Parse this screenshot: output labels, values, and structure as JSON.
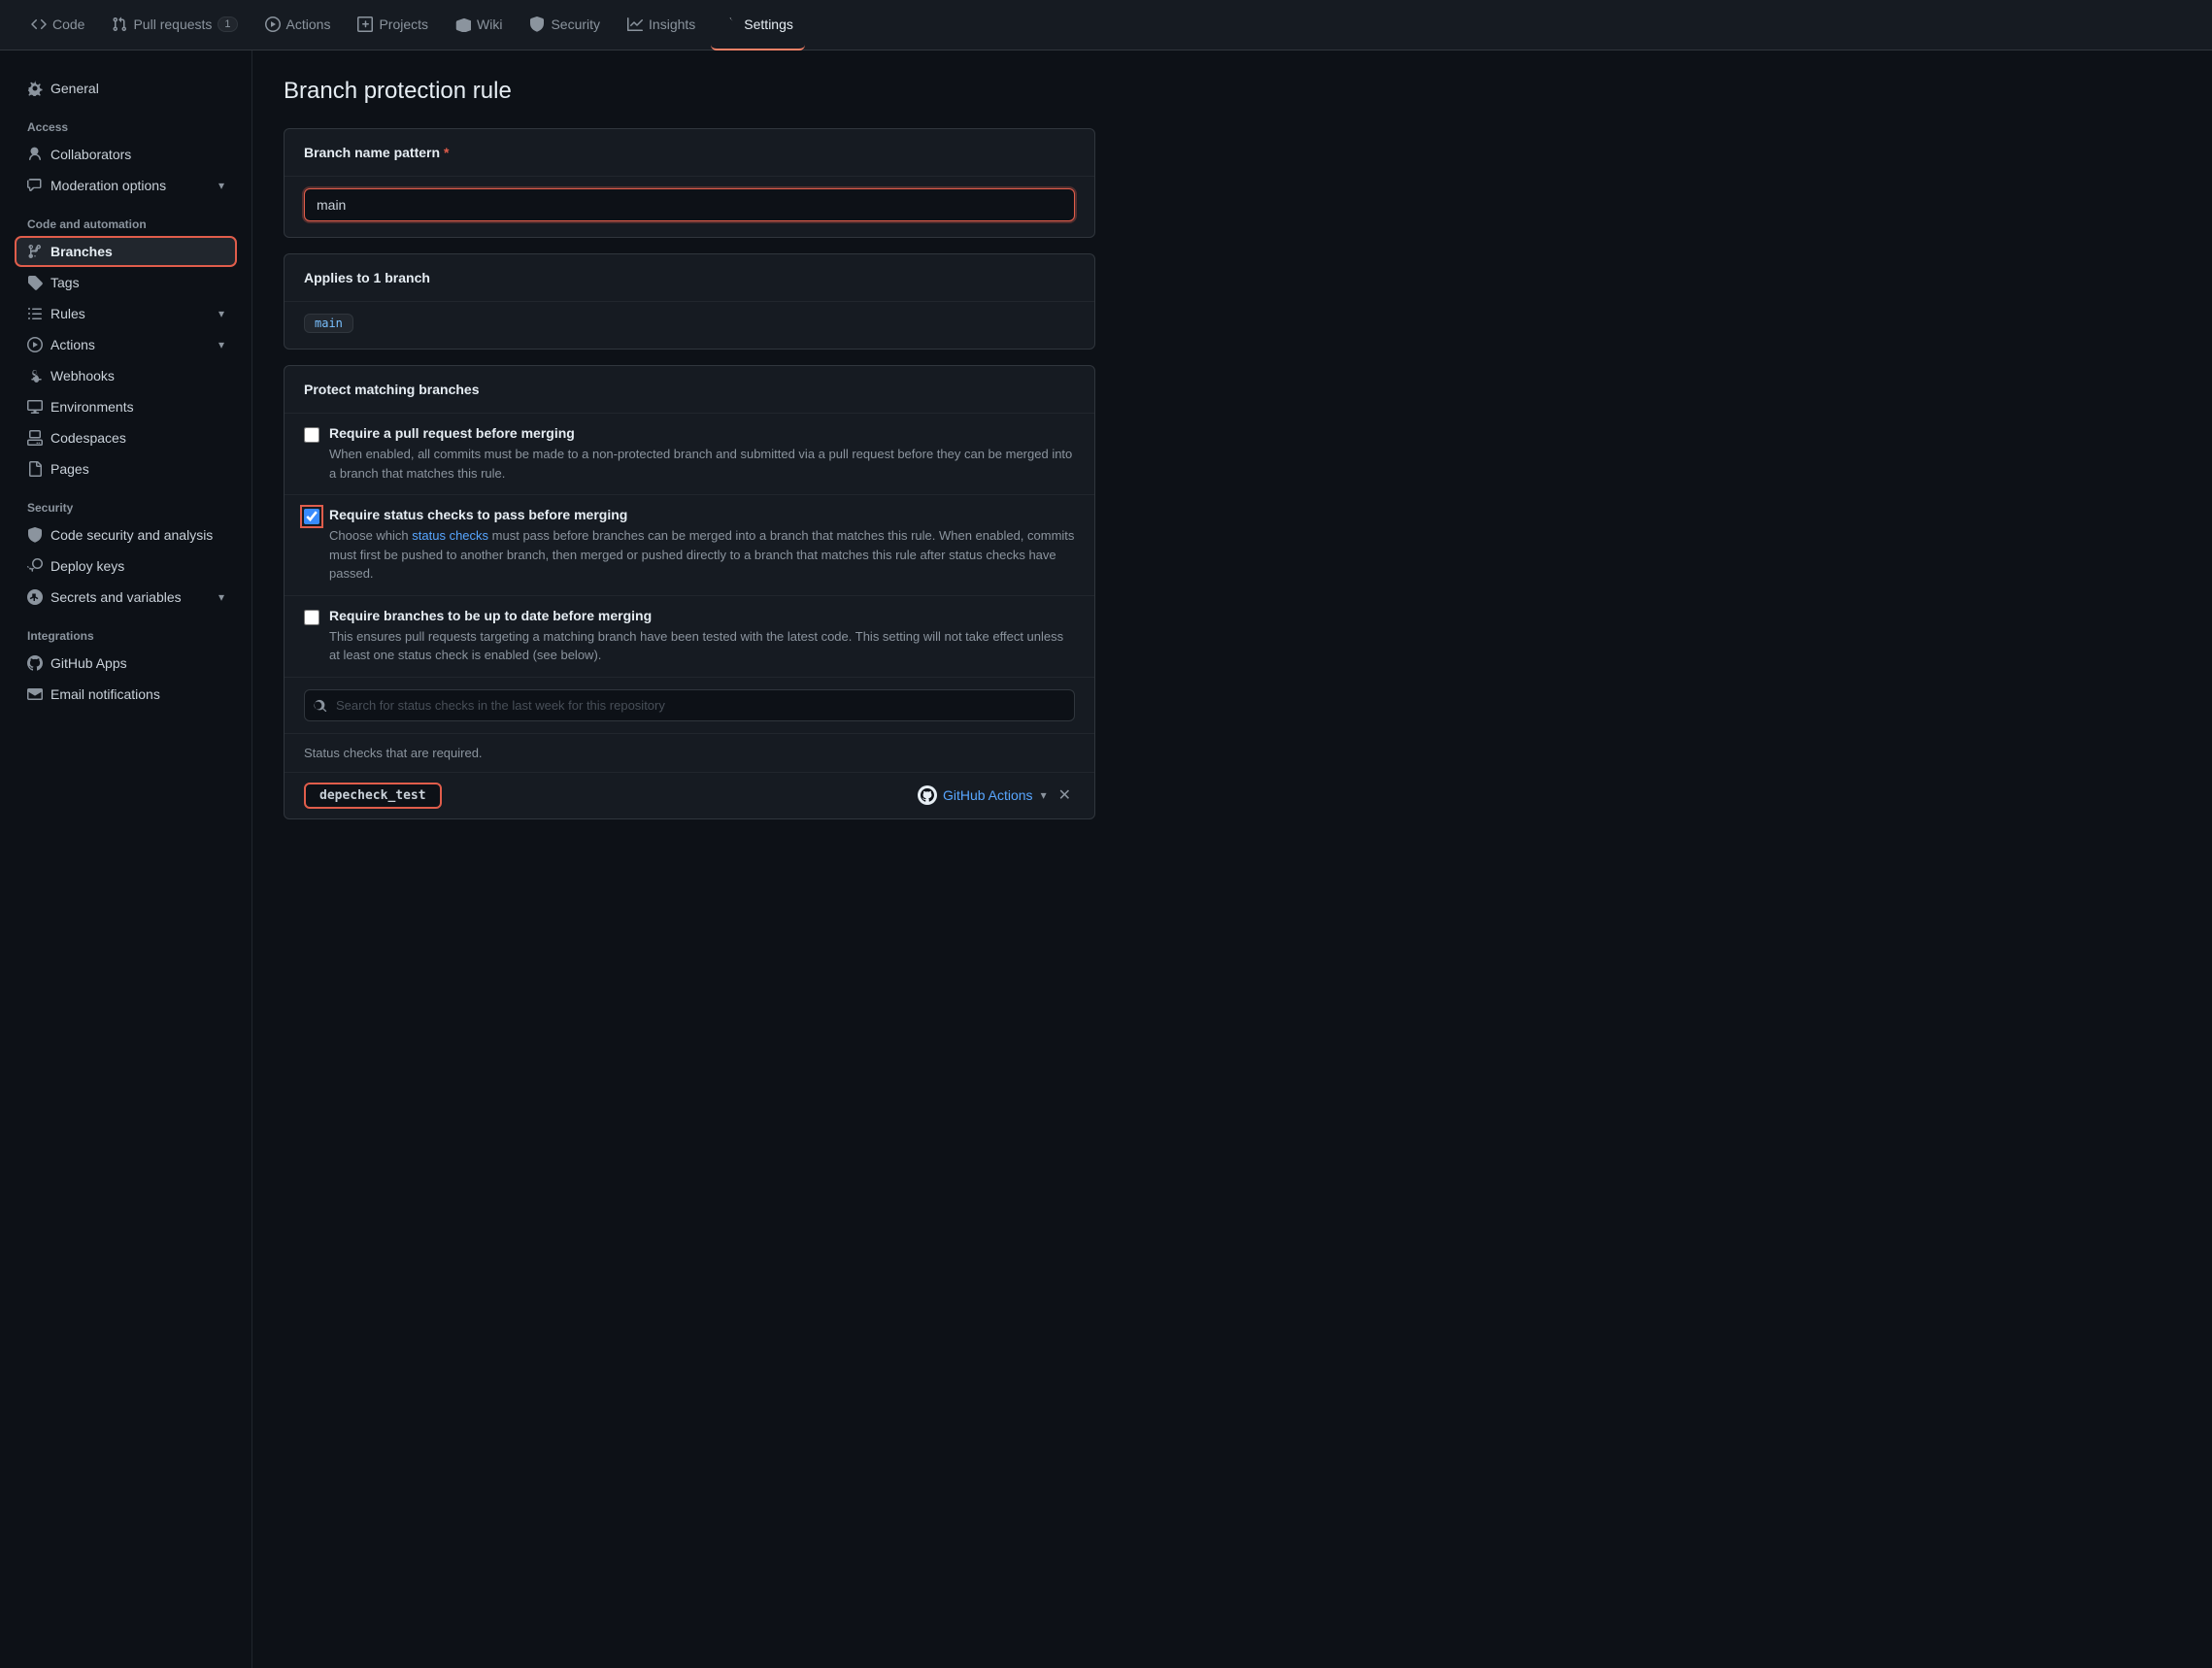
{
  "nav": {
    "items": [
      {
        "id": "code",
        "label": "Code",
        "icon": "code",
        "badge": null,
        "active": false
      },
      {
        "id": "pull-requests",
        "label": "Pull requests",
        "icon": "pull-request",
        "badge": "1",
        "active": false
      },
      {
        "id": "actions",
        "label": "Actions",
        "icon": "actions",
        "badge": null,
        "active": false
      },
      {
        "id": "projects",
        "label": "Projects",
        "icon": "projects",
        "badge": null,
        "active": false
      },
      {
        "id": "wiki",
        "label": "Wiki",
        "icon": "wiki",
        "badge": null,
        "active": false
      },
      {
        "id": "security",
        "label": "Security",
        "icon": "security",
        "badge": null,
        "active": false
      },
      {
        "id": "insights",
        "label": "Insights",
        "icon": "insights",
        "badge": null,
        "active": false
      },
      {
        "id": "settings",
        "label": "Settings",
        "icon": "settings",
        "badge": null,
        "active": true
      }
    ]
  },
  "sidebar": {
    "top_item": {
      "label": "General",
      "icon": "gear"
    },
    "sections": [
      {
        "label": "Access",
        "items": [
          {
            "id": "collaborators",
            "label": "Collaborators",
            "icon": "person",
            "active": false
          },
          {
            "id": "moderation-options",
            "label": "Moderation options",
            "icon": "comment",
            "active": false,
            "has_chevron": true
          }
        ]
      },
      {
        "label": "Code and automation",
        "items": [
          {
            "id": "branches",
            "label": "Branches",
            "icon": "git-branch",
            "active": true
          },
          {
            "id": "tags",
            "label": "Tags",
            "icon": "tag",
            "active": false
          },
          {
            "id": "rules",
            "label": "Rules",
            "icon": "list",
            "active": false,
            "has_chevron": true
          },
          {
            "id": "actions",
            "label": "Actions",
            "icon": "actions2",
            "active": false,
            "has_chevron": true
          },
          {
            "id": "webhooks",
            "label": "Webhooks",
            "icon": "webhook",
            "active": false
          },
          {
            "id": "environments",
            "label": "Environments",
            "icon": "environment",
            "active": false
          },
          {
            "id": "codespaces",
            "label": "Codespaces",
            "icon": "codespaces",
            "active": false
          },
          {
            "id": "pages",
            "label": "Pages",
            "icon": "pages",
            "active": false
          }
        ]
      },
      {
        "label": "Security",
        "items": [
          {
            "id": "code-security",
            "label": "Code security and analysis",
            "icon": "shield",
            "active": false
          },
          {
            "id": "deploy-keys",
            "label": "Deploy keys",
            "icon": "key",
            "active": false
          },
          {
            "id": "secrets-variables",
            "label": "Secrets and variables",
            "icon": "asterisk",
            "active": false,
            "has_chevron": true
          }
        ]
      },
      {
        "label": "Integrations",
        "items": [
          {
            "id": "github-apps",
            "label": "GitHub Apps",
            "icon": "apps",
            "active": false
          },
          {
            "id": "email-notifications",
            "label": "Email notifications",
            "icon": "mail",
            "active": false
          }
        ]
      }
    ]
  },
  "main": {
    "page_title": "Branch protection rule",
    "branch_name_section": {
      "label": "Branch name pattern",
      "required": true,
      "input_value": "main"
    },
    "applies_section": {
      "label": "Applies to 1 branch",
      "branch_tag": "main"
    },
    "protect_section": {
      "label": "Protect matching branches",
      "options": [
        {
          "id": "require-pr",
          "label": "Require a pull request before merging",
          "description": "When enabled, all commits must be made to a non-protected branch and submitted via a pull request before they can be merged into a branch that matches this rule.",
          "checked": false,
          "highlighted": false
        },
        {
          "id": "require-status-checks",
          "label": "Require status checks to pass before merging",
          "description": "Choose which {status_checks_link} must pass before branches can be merged into a branch that matches this rule. When enabled, commits must first be pushed to another branch, then merged or pushed directly to a branch that matches this rule after status checks have passed.",
          "status_checks_link_text": "status checks",
          "checked": true,
          "highlighted": true
        },
        {
          "id": "require-up-to-date",
          "label": "Require branches to be up to date before merging",
          "description": "This ensures pull requests targeting a matching branch have been tested with the latest code. This setting will not take effect unless at least one status check is enabled (see below).",
          "checked": false,
          "highlighted": false
        }
      ]
    },
    "status_checks": {
      "search_placeholder": "Search for status checks in the last week for this repository",
      "required_label": "Status checks that are required.",
      "depecheck_item": {
        "name": "depecheck_test",
        "provider": "GitHub Actions",
        "dropdown_label": "▾",
        "close_label": "✕"
      }
    }
  }
}
